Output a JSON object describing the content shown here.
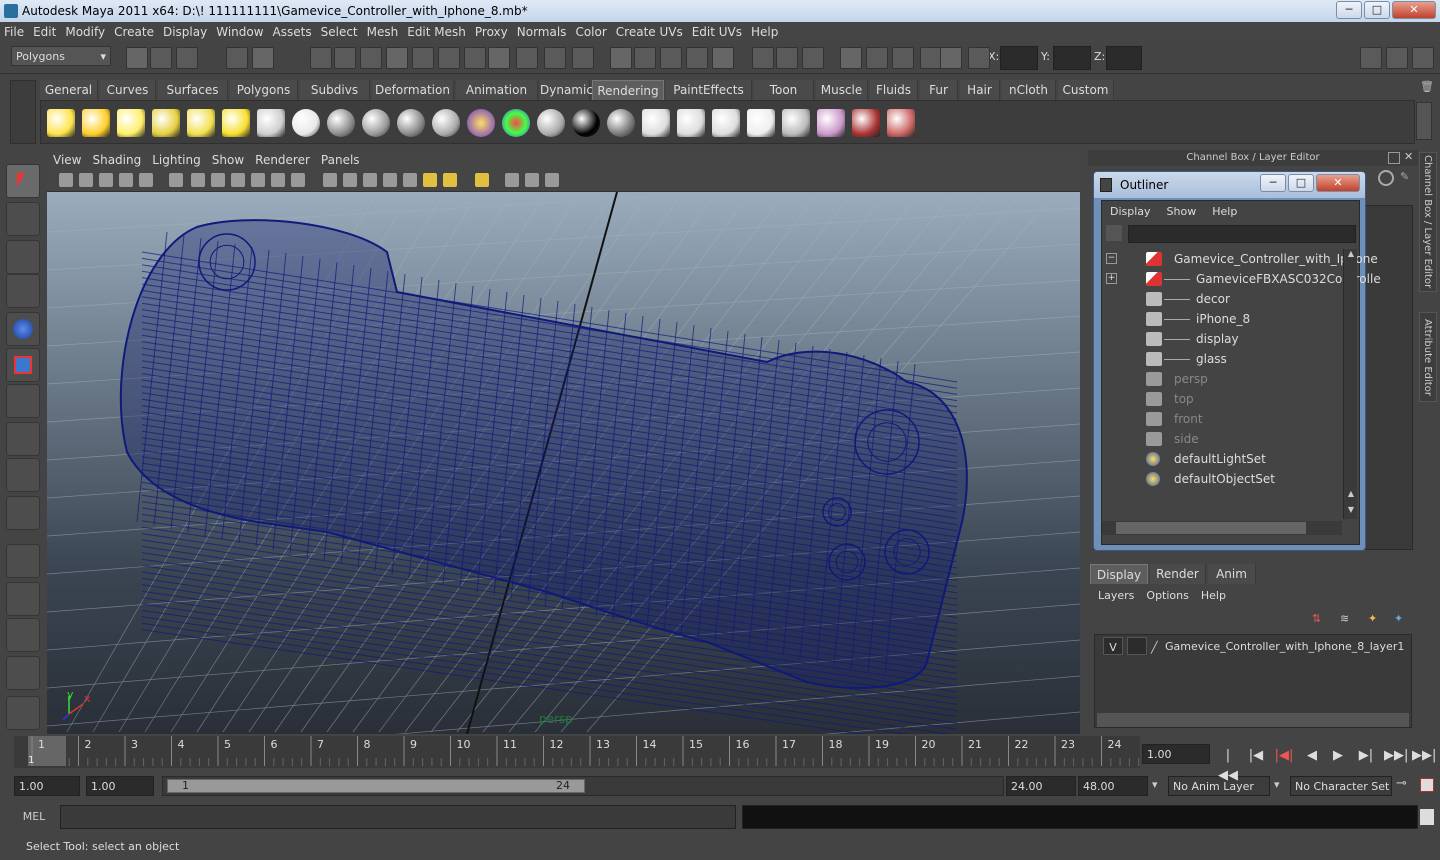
{
  "window": {
    "title": "Autodesk Maya 2011 x64: D:\\! 111111111\\Gamevice_Controller_with_Iphone_8.mb*",
    "minimize": "─",
    "maximize": "□",
    "close": "✕"
  },
  "menubar": [
    "File",
    "Edit",
    "Modify",
    "Create",
    "Display",
    "Window",
    "Assets",
    "Select",
    "Mesh",
    "Edit Mesh",
    "Proxy",
    "Normals",
    "Color",
    "Create UVs",
    "Edit UVs",
    "Help"
  ],
  "status": {
    "mode": "Polygons",
    "x_label": "X:",
    "y_label": "Y:",
    "z_label": "Z:"
  },
  "shelf_tabs": [
    {
      "label": "General"
    },
    {
      "label": "Curves"
    },
    {
      "label": "Surfaces"
    },
    {
      "label": "Polygons"
    },
    {
      "label": "Subdivs"
    },
    {
      "label": "Deformation"
    },
    {
      "label": "Animation"
    },
    {
      "label": "Dynamics"
    },
    {
      "label": "Rendering",
      "active": true
    },
    {
      "label": "PaintEffects"
    },
    {
      "label": "Toon"
    },
    {
      "label": "Muscle"
    },
    {
      "label": "Fluids"
    },
    {
      "label": "Fur"
    },
    {
      "label": "Hair"
    },
    {
      "label": "nCloth"
    },
    {
      "label": "Custom"
    }
  ],
  "shelf_icons": [
    "spot-light-icon",
    "area-light-icon",
    "point-light-icon",
    "directional-light-icon",
    "volume-light-icon",
    "ambient-light-icon",
    "camera-icon",
    "lambert-sphere-icon",
    "blinn-sphere-icon",
    "phong-sphere-icon",
    "anisotropic-sphere-icon",
    "phongE-sphere-icon",
    "layered-shader-icon",
    "ramp-shader-icon",
    "surface-shader-gray-icon",
    "black-shader-icon",
    "use-background-icon",
    "render-view-icon",
    "render-current-icon",
    "ipr-render-icon",
    "render-settings-icon",
    "hypershade-icon",
    "render-layer-icon",
    "batch-render-icon",
    "paint-canvas-icon"
  ],
  "viewport": {
    "menu": [
      "View",
      "Shading",
      "Lighting",
      "Show",
      "Renderer",
      "Panels"
    ],
    "camera_label": "persp",
    "axis_x": "x",
    "axis_y": "y"
  },
  "channel_box_title": "Channel Box / Layer Editor",
  "side_tabs": [
    "Channel Box / Layer Editor",
    "Attribute Editor"
  ],
  "outliner": {
    "title": "Outliner",
    "menu": [
      "Display",
      "Show",
      "Help"
    ],
    "items": [
      {
        "label": "Gamevice_Controller_with_Iphone",
        "indent": 0,
        "expander": "−",
        "icon": "transform-icon",
        "dim": false
      },
      {
        "label": "GameviceFBXASC032Controlle",
        "indent": 1,
        "expander": "+",
        "icon": "transform-icon",
        "dim": false
      },
      {
        "label": "decor",
        "indent": 1,
        "expander": "",
        "icon": "mesh-icon",
        "dim": false
      },
      {
        "label": "iPhone_8",
        "indent": 1,
        "expander": "",
        "icon": "mesh-icon",
        "dim": false
      },
      {
        "label": "display",
        "indent": 1,
        "expander": "",
        "icon": "mesh-icon",
        "dim": false
      },
      {
        "label": "glass",
        "indent": 1,
        "expander": "",
        "icon": "mesh-icon",
        "dim": false
      },
      {
        "label": "persp",
        "indent": 0,
        "expander": "",
        "icon": "camera-icon",
        "dim": true
      },
      {
        "label": "top",
        "indent": 0,
        "expander": "",
        "icon": "camera-icon",
        "dim": true
      },
      {
        "label": "front",
        "indent": 0,
        "expander": "",
        "icon": "camera-icon",
        "dim": true
      },
      {
        "label": "side",
        "indent": 0,
        "expander": "",
        "icon": "camera-icon",
        "dim": true
      },
      {
        "label": "defaultLightSet",
        "indent": 0,
        "expander": "",
        "icon": "set-icon",
        "dim": false
      },
      {
        "label": "defaultObjectSet",
        "indent": 0,
        "expander": "",
        "icon": "set-icon",
        "dim": false
      }
    ]
  },
  "layer_editor": {
    "tabs": [
      {
        "label": "Display",
        "active": true
      },
      {
        "label": "Render"
      },
      {
        "label": "Anim"
      }
    ],
    "menu": [
      "Layers",
      "Options",
      "Help"
    ],
    "visibility": "V",
    "layer_name": "Gamevice_Controller_with_Iphone_8_layer1"
  },
  "timeline": {
    "ticks": [
      "1",
      "2",
      "3",
      "4",
      "5",
      "6",
      "7",
      "8",
      "9",
      "10",
      "11",
      "12",
      "13",
      "14",
      "15",
      "16",
      "17",
      "18",
      "19",
      "20",
      "21",
      "22",
      "23",
      "24"
    ],
    "current_frame_marker": "1",
    "current_time": "1.00",
    "playback": [
      "|◀◀",
      "|◀",
      "|◀|",
      "◀",
      "▶",
      "▶|",
      "▶▶|",
      "▶▶|"
    ]
  },
  "range": {
    "start": "1.00",
    "playback_start": "1.00",
    "slider_start": "1",
    "slider_end": "24",
    "playback_end": "24.00",
    "end": "48.00",
    "anim_layer": "No Anim Layer",
    "character_set": "No Character Set"
  },
  "command_line": {
    "label": "MEL"
  },
  "help_line": "Select Tool: select an object",
  "colors": {
    "wireframe": "#0f1a7a",
    "accent": "#6f8fb8"
  }
}
